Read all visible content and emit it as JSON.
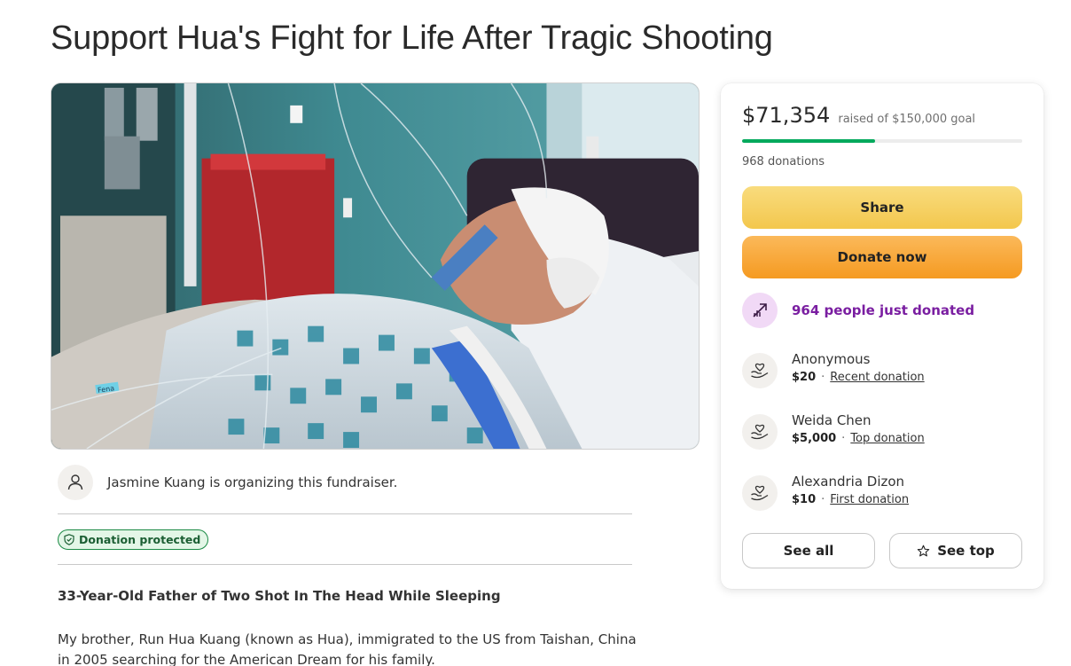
{
  "page": {
    "title": "Support Hua's Fight for Life After Tragic Shooting"
  },
  "hero": {
    "tape_text": "Fena"
  },
  "organizer": {
    "text": "Jasmine Kuang is organizing this fundraiser.",
    "icon": "person-icon"
  },
  "badge": {
    "label": "Donation protected",
    "icon": "shield-icon"
  },
  "story": {
    "title": "33-Year-Old Father of Two Shot In The Head While Sleeping",
    "body": "My brother, Run Hua Kuang (known as Hua), immigrated to the US from Taishan, China in 2005 searching for the American Dream for his family."
  },
  "card": {
    "raised": "$71,354",
    "goal_text": "raised of $150,000 goal",
    "progress": 0.4757,
    "donations_count": "968 donations",
    "share_label": "Share",
    "donate_label": "Donate now",
    "trend_text": "964 people just donated",
    "trend_icon": "trending-up-icon",
    "donors": [
      {
        "name": "Anonymous",
        "amount": "$20",
        "tag": "Recent donation"
      },
      {
        "name": "Weida Chen",
        "amount": "$5,000",
        "tag": "Top donation"
      },
      {
        "name": "Alexandria Dizon",
        "amount": "$10",
        "tag": "First donation"
      }
    ],
    "see_all_label": "See all",
    "see_top_label": "See top"
  },
  "colors": {
    "progress": "#02a95c",
    "share": "#f3c74d",
    "donate": "#f59a21",
    "trend": "#7a1ea1",
    "badge": "#1b8a45"
  }
}
